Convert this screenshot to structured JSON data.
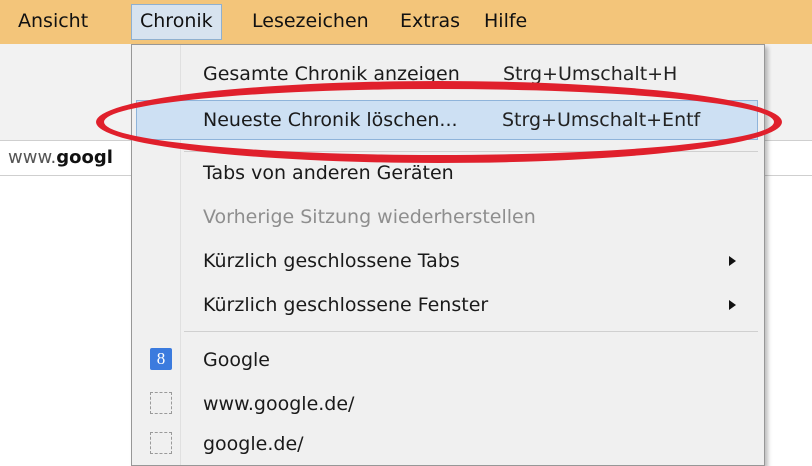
{
  "menubar": {
    "items": [
      {
        "label": "Ansicht"
      },
      {
        "label": "Chronik"
      },
      {
        "label": "Lesezeichen"
      },
      {
        "label": "Extras"
      },
      {
        "label": "Hilfe"
      }
    ]
  },
  "urlbar": {
    "prefix": "www.",
    "bold": "googl"
  },
  "menu": {
    "items": [
      {
        "label": "Gesamte Chronik anzeigen",
        "shortcut": "Strg+Umschalt+H"
      },
      {
        "label": "Neueste Chronik löschen...",
        "shortcut": "Strg+Umschalt+Entf"
      },
      {
        "label": "Tabs von anderen Geräten"
      },
      {
        "label": "Vorherige Sitzung wiederherstellen"
      },
      {
        "label": "Kürzlich geschlossene Tabs"
      },
      {
        "label": "Kürzlich geschlossene Fenster"
      },
      {
        "label": "Google",
        "icon_text": "8"
      },
      {
        "label": "www.google.de/"
      },
      {
        "label": "google.de/"
      }
    ]
  },
  "colors": {
    "menubar_bg": "#f3c57a",
    "highlight": "#cde0f3",
    "annotation_oval": "#e0202c"
  }
}
